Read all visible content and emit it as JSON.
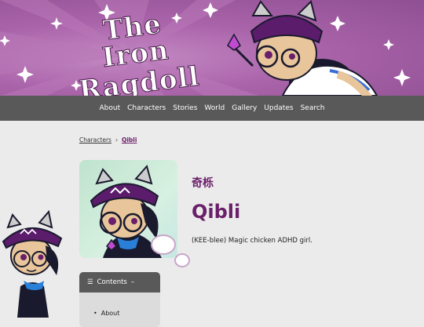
{
  "site": {
    "title_line1": "The Iron",
    "title_line2": "Ragdoll"
  },
  "nav": {
    "items": [
      "About",
      "Characters",
      "Stories",
      "World",
      "Gallery",
      "Updates",
      "Search"
    ]
  },
  "breadcrumb": {
    "parent": "Characters",
    "separator": "›",
    "current": "Qibli"
  },
  "character": {
    "name_native": "奇栎",
    "name": "Qibli",
    "tagline": "(KEE-blee) Magic chicken ADHD girl."
  },
  "toc": {
    "title": "Contents",
    "toggle": "–",
    "items": [
      "About"
    ]
  },
  "colors": {
    "accent": "#6a1f6a",
    "nav_bg": "#595959",
    "banner": "#a963a9",
    "page_bg": "#ebebeb"
  }
}
